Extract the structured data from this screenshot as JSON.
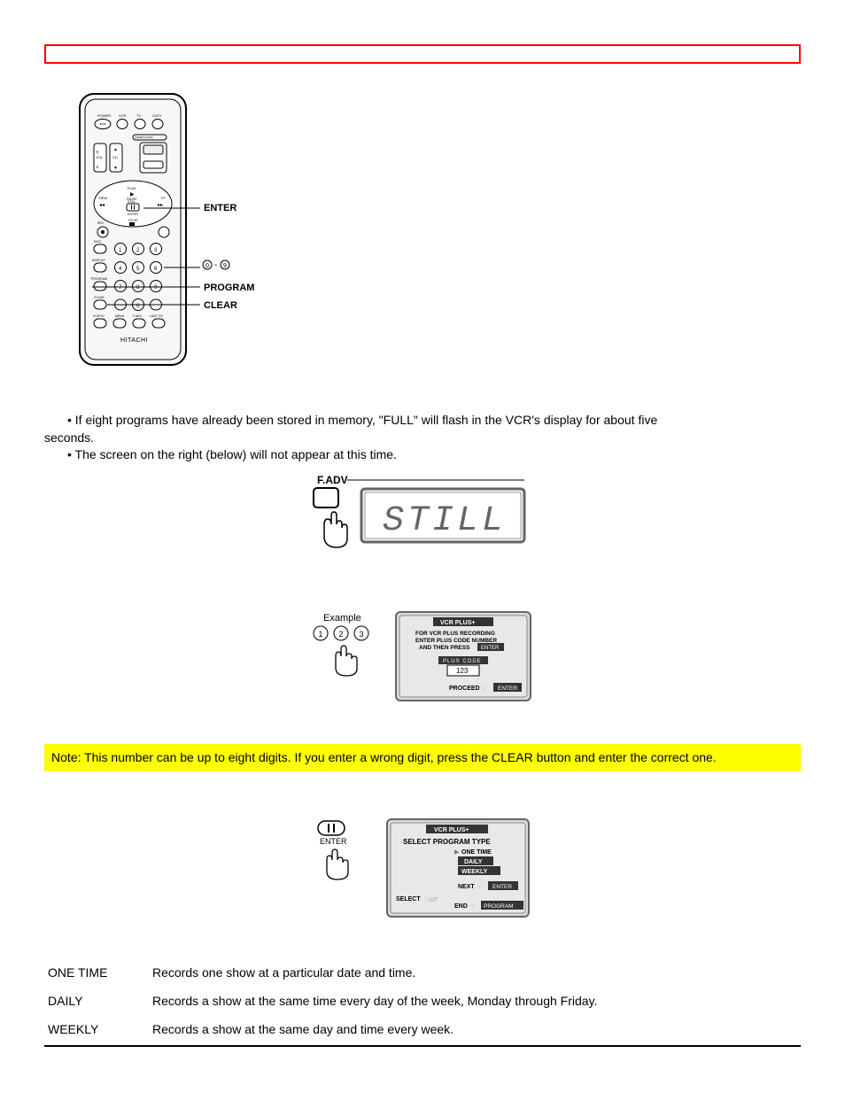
{
  "remote_labels": {
    "enter": "ENTER",
    "digits": "0 - 9",
    "program": "PROGRAM",
    "clear": "CLEAR",
    "brand": "HITACHI"
  },
  "remote_internal": {
    "power": "POWER",
    "vcr": "VCR",
    "tv": "TV",
    "catv": "CATV",
    "super": "SUPER QUICK",
    "vol": "VOL",
    "ch": "CH",
    "play": "PLAY",
    "rew": "REW",
    "ff": "FF",
    "pause": "PAUSE",
    "still": "STILL",
    "enter": "ENTER",
    "rec": "REC",
    "stop": "STOP",
    "disc": "DISC",
    "display": "DISPLAY",
    "program": "PROGRAM",
    "clear": "CLEAR",
    "vcrtv": "VCR/TV",
    "menu": "MENU",
    "fadv": "F.ADV",
    "lastch": "LAST CH"
  },
  "bullets": {
    "b1a": "If eight programs have already been stored in memory, \"FULL\" will flash in the VCR's display for about five",
    "b1b": "seconds.",
    "b2": "The screen on the right (below) will not appear at this time."
  },
  "fadv": {
    "label": "F.ADV",
    "display": "STILL"
  },
  "pluscode": {
    "example": "Example",
    "d1": "1",
    "d2": "2",
    "d3": "3",
    "screen_title": "VCR PLUS+",
    "line1": "FOR VCR PLUS RECORDING",
    "line2": "ENTER PLUS CODE NUMBER",
    "line3a": "AND THEN PRESS",
    "line3b": "ENTER",
    "box_label": "PLUS  CODE",
    "box_value": "123",
    "proceed1": "PROCEED",
    "proceed2": "ENTER"
  },
  "note": "Note: This number can be up to eight digits. If you enter a wrong digit, press the CLEAR button and enter the correct one.",
  "progtype": {
    "pause_icon": "II",
    "enter": "ENTER",
    "title": "VCR PLUS+",
    "subtitle": "SELECT PROGRAM TYPE",
    "opt1": "ONE TIME",
    "opt2": "DAILY",
    "opt3": "WEEKLY",
    "next1": "NEXT",
    "next2": "ENTER",
    "select": "SELECT",
    "end1": "END",
    "end2": "PROGRAM"
  },
  "defs": {
    "one_time": {
      "term": "ONE TIME",
      "desc": "Records one show at a particular date and time."
    },
    "daily": {
      "term": "DAILY",
      "desc": "Records a show at the same time every day of the week, Monday through Friday."
    },
    "weekly": {
      "term": "WEEKLY",
      "desc": "Records a show at the same day and time every week."
    }
  }
}
